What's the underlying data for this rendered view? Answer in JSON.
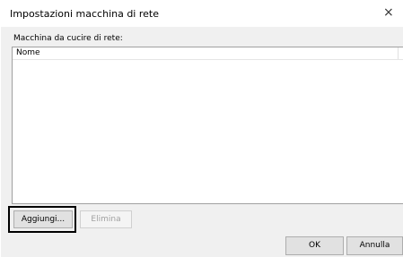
{
  "window": {
    "title": "Impostazioni macchina di rete",
    "close_glyph": "×"
  },
  "list": {
    "label": "Macchina da cucire di rete:",
    "column_header": "Nome",
    "rows": []
  },
  "buttons": {
    "add_label": "Aggiungi...",
    "delete_label": "Elimina",
    "ok_label": "OK",
    "cancel_label": "Annulla"
  },
  "icons": {
    "close": "close-icon"
  }
}
